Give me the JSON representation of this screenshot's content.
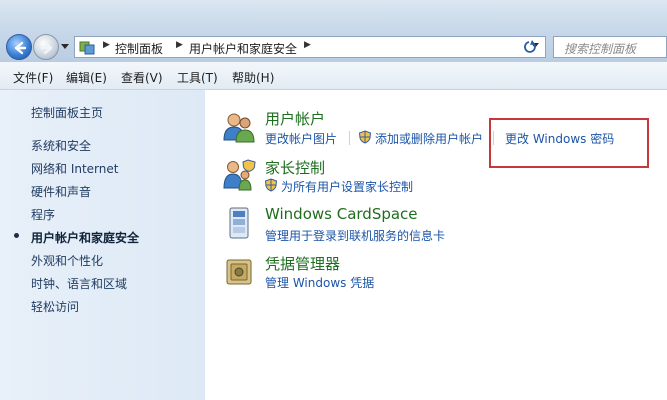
{
  "address": {
    "breadcrumb": [
      "控制面板",
      "用户帐户和家庭安全"
    ]
  },
  "search": {
    "placeholder": "搜索控制面板"
  },
  "menu": [
    "文件(F)",
    "编辑(E)",
    "查看(V)",
    "工具(T)",
    "帮助(H)"
  ],
  "sidebar": {
    "items": [
      {
        "label": "控制面板主页"
      },
      {
        "label": "系统和安全"
      },
      {
        "label": "网络和 Internet"
      },
      {
        "label": "硬件和声音"
      },
      {
        "label": "程序"
      },
      {
        "label": "用户帐户和家庭安全",
        "active": true
      },
      {
        "label": "外观和个性化"
      },
      {
        "label": "时钟、语言和区域"
      },
      {
        "label": "轻松访问"
      }
    ]
  },
  "categories": [
    {
      "title": "用户帐户",
      "links": [
        "更改帐户图片",
        "添加或删除用户帐户",
        "更改 Windows 密码"
      ]
    },
    {
      "title": "家长控制",
      "links": [
        "为所有用户设置家长控制"
      ]
    },
    {
      "title": "Windows CardSpace",
      "links": [
        "管理用于登录到联机服务的信息卡"
      ]
    },
    {
      "title": "凭据管理器",
      "links": [
        "管理 Windows 凭据"
      ]
    }
  ],
  "icons": {
    "back": "back-arrow-icon",
    "forward": "forward-arrow-icon",
    "refresh": "refresh-icon",
    "users": "users-icon",
    "parental": "parental-controls-icon",
    "cardspace": "cardspace-icon",
    "credential": "credential-manager-icon",
    "shield": "uac-shield-icon"
  },
  "colors": {
    "category_title": "#1e6e1e",
    "link": "#1b55a8",
    "highlight_box": "#c8383b"
  }
}
